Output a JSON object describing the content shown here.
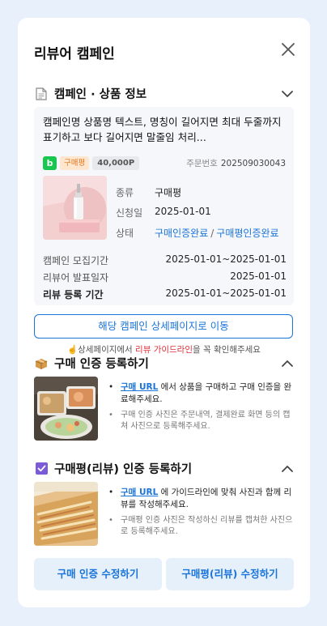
{
  "modal": {
    "title": "리뷰어 캠페인"
  },
  "section_info": {
    "title": "캠페인 · 상품 정보",
    "campaign_name": "캠페인명 상품명 텍스트, 명칭이 길어지면 최대 두줄까지 표기하고 보다 길어지면 말줄임 처리...",
    "logo_letter": "b",
    "type_badge": "구매평",
    "point_badge": "40,000P",
    "order_label": "주문번호",
    "order_number": "202509030043",
    "rows": [
      {
        "key": "종류",
        "value": "구매평"
      },
      {
        "key": "신청일",
        "value": "2025-01-01"
      },
      {
        "key": "상태",
        "value": "구매인증완료",
        "value2": "구매평인증완료",
        "sep": "/"
      }
    ],
    "periods": [
      {
        "key": "캠페인 모집기간",
        "value": "2025-01-01~2025-01-01"
      },
      {
        "key": "리뷰어 발표일자",
        "value": "2025-01-01"
      },
      {
        "key": "리뷰 등록 기간",
        "value": "2025-01-01~2025-01-01"
      }
    ]
  },
  "detail_button": "해당 캠페인 상세페이지로 이동",
  "notice": {
    "prefix": "☝️상세페이지에서 ",
    "highlight": "리뷰 가이드라인",
    "suffix": "을 꼭 확인해주세요"
  },
  "purchase": {
    "title": "구매 인증 등록하기",
    "link": "구매 URL",
    "text": " 에서 상품을 구매하고 구매 인증을 완료해주세요.",
    "sub": "구매 인증 사진은 주문내역, 결제완료 화면 등의 캡쳐 사진으로 등록해주세요."
  },
  "review": {
    "title": "구매평(리뷰) 인증 등록하기",
    "link": "구매 URL",
    "text": " 에 가이드라인에 맞춰 사진과 함께 리뷰를 작성해주세요.",
    "sub": "구매평 인증 사진은 작성하신 리뷰를 캡쳐한 사진으로 등록해주세요."
  },
  "buttons": {
    "edit_purchase": "구매 인증 수정하기",
    "edit_review": "구매평(리뷰) 수정하기"
  },
  "colors": {
    "accent": "#1a74d9",
    "brand_green": "#19c64f",
    "warn_red": "#e0303a",
    "badge_orange": "#e2751c"
  }
}
